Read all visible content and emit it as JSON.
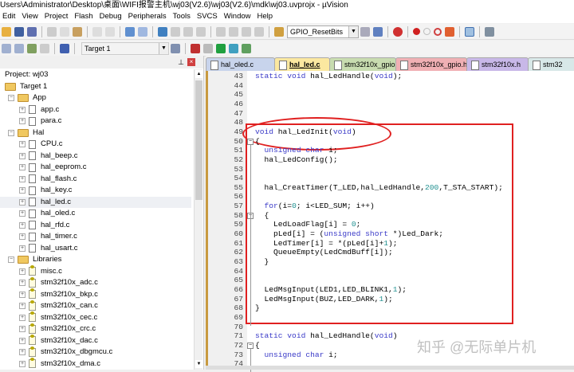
{
  "window": {
    "title": "Users\\Administrator\\Desktop\\桌面\\WIFI报警主机\\wj03(V2.6)\\wj03(V2.6)\\mdk\\wj03.uvprojx - µVision"
  },
  "menu": [
    "Edit",
    "View",
    "Project",
    "Flash",
    "Debug",
    "Peripherals",
    "Tools",
    "SVCS",
    "Window",
    "Help"
  ],
  "toolbar": {
    "function_combo": "GPIO_ResetBits",
    "target_combo": "Target 1"
  },
  "project": {
    "header": "Project: wj03",
    "target": "Target 1",
    "groups": [
      {
        "name": "App",
        "files": [
          "app.c",
          "para.c"
        ]
      },
      {
        "name": "Hal",
        "files": [
          "CPU.c",
          "hal_beep.c",
          "hal_eeprom.c",
          "hal_flash.c",
          "hal_key.c",
          "hal_led.c",
          "hal_oled.c",
          "hal_rfd.c",
          "hal_timer.c",
          "hal_usart.c"
        ]
      },
      {
        "name": "Libraries",
        "files": [
          "misc.c",
          "stm32f10x_adc.c",
          "stm32f10x_bkp.c",
          "stm32f10x_can.c",
          "stm32f10x_cec.c",
          "stm32f10x_crc.c",
          "stm32f10x_dac.c",
          "stm32f10x_dbgmcu.c",
          "stm32f10x_dma.c"
        ]
      }
    ],
    "selected": "hal_led.c"
  },
  "tabs": [
    {
      "label": "hal_oled.c",
      "color": "#c8d4ec"
    },
    {
      "label": "hal_led.c",
      "color": "#fbe8a0",
      "active": true
    },
    {
      "label": "stm32f10x_gpio.c",
      "color": "#c8dcb0"
    },
    {
      "label": "stm32f10x_gpio.h",
      "color": "#f0b0b4"
    },
    {
      "label": "stm32f10x.h",
      "color": "#c8b8e8"
    },
    {
      "label": "stm32",
      "color": "#d8e8e8"
    }
  ],
  "editor": {
    "first_line": 43,
    "lines": [
      [
        [
          "kw",
          "static void "
        ],
        [
          "",
          "hal_LedHandle("
        ],
        [
          "kw",
          "void"
        ],
        [
          "",
          ");"
        ]
      ],
      [],
      [],
      [],
      [],
      [],
      [
        [
          "kw",
          "void "
        ],
        [
          "",
          "hal_LedInit("
        ],
        [
          "kw",
          "void"
        ],
        [
          "",
          ")"
        ]
      ],
      [
        [
          "",
          "{"
        ]
      ],
      [
        [
          "kw",
          "  unsigned char "
        ],
        [
          "",
          "i;"
        ]
      ],
      [
        [
          "",
          "  hal_LedConfig();"
        ]
      ],
      [],
      [],
      [
        [
          "",
          "  hal_CreatTimer(T_LED,hal_LedHandle,"
        ],
        [
          "num",
          "200"
        ],
        [
          "",
          ",T_STA_START);"
        ]
      ],
      [],
      [
        [
          "kw",
          "  for"
        ],
        [
          "",
          "(i="
        ],
        [
          "num",
          "0"
        ],
        [
          "",
          "; i<LED_SUM; i++)"
        ]
      ],
      [
        [
          "",
          "  {"
        ]
      ],
      [
        [
          "",
          "    LedLoadFlag[i] = "
        ],
        [
          "num",
          "0"
        ],
        [
          "",
          ";"
        ]
      ],
      [
        [
          "",
          "    pLed[i] = ("
        ],
        [
          "kw",
          "unsigned short"
        ],
        [
          "",
          " *)Led_Dark;"
        ]
      ],
      [
        [
          "",
          "    LedTimer[i] = *(pLed[i]+"
        ],
        [
          "num",
          "1"
        ],
        [
          "",
          ");"
        ]
      ],
      [
        [
          "",
          "    QueueEmpty(LedCmdBuff[i]);"
        ]
      ],
      [
        [
          "",
          "  }"
        ]
      ],
      [],
      [],
      [
        [
          "",
          "  LedMsgInput(LED1,LED_BLINK1,"
        ],
        [
          "num",
          "1"
        ],
        [
          "",
          ");"
        ]
      ],
      [
        [
          "",
          "  LedMsgInput(BUZ,LED_DARK,"
        ],
        [
          "num",
          "1"
        ],
        [
          "",
          ");"
        ]
      ],
      [
        [
          "",
          "}"
        ]
      ],
      [],
      [],
      [
        [
          "kw",
          "static void "
        ],
        [
          "",
          "hal_LedHandle("
        ],
        [
          "kw",
          "void"
        ],
        [
          "",
          ")"
        ]
      ],
      [
        [
          "",
          "{"
        ]
      ],
      [
        [
          "kw",
          "  unsigned char "
        ],
        [
          "",
          "i;"
        ]
      ],
      []
    ]
  },
  "watermark": "知乎 @无际单片机"
}
